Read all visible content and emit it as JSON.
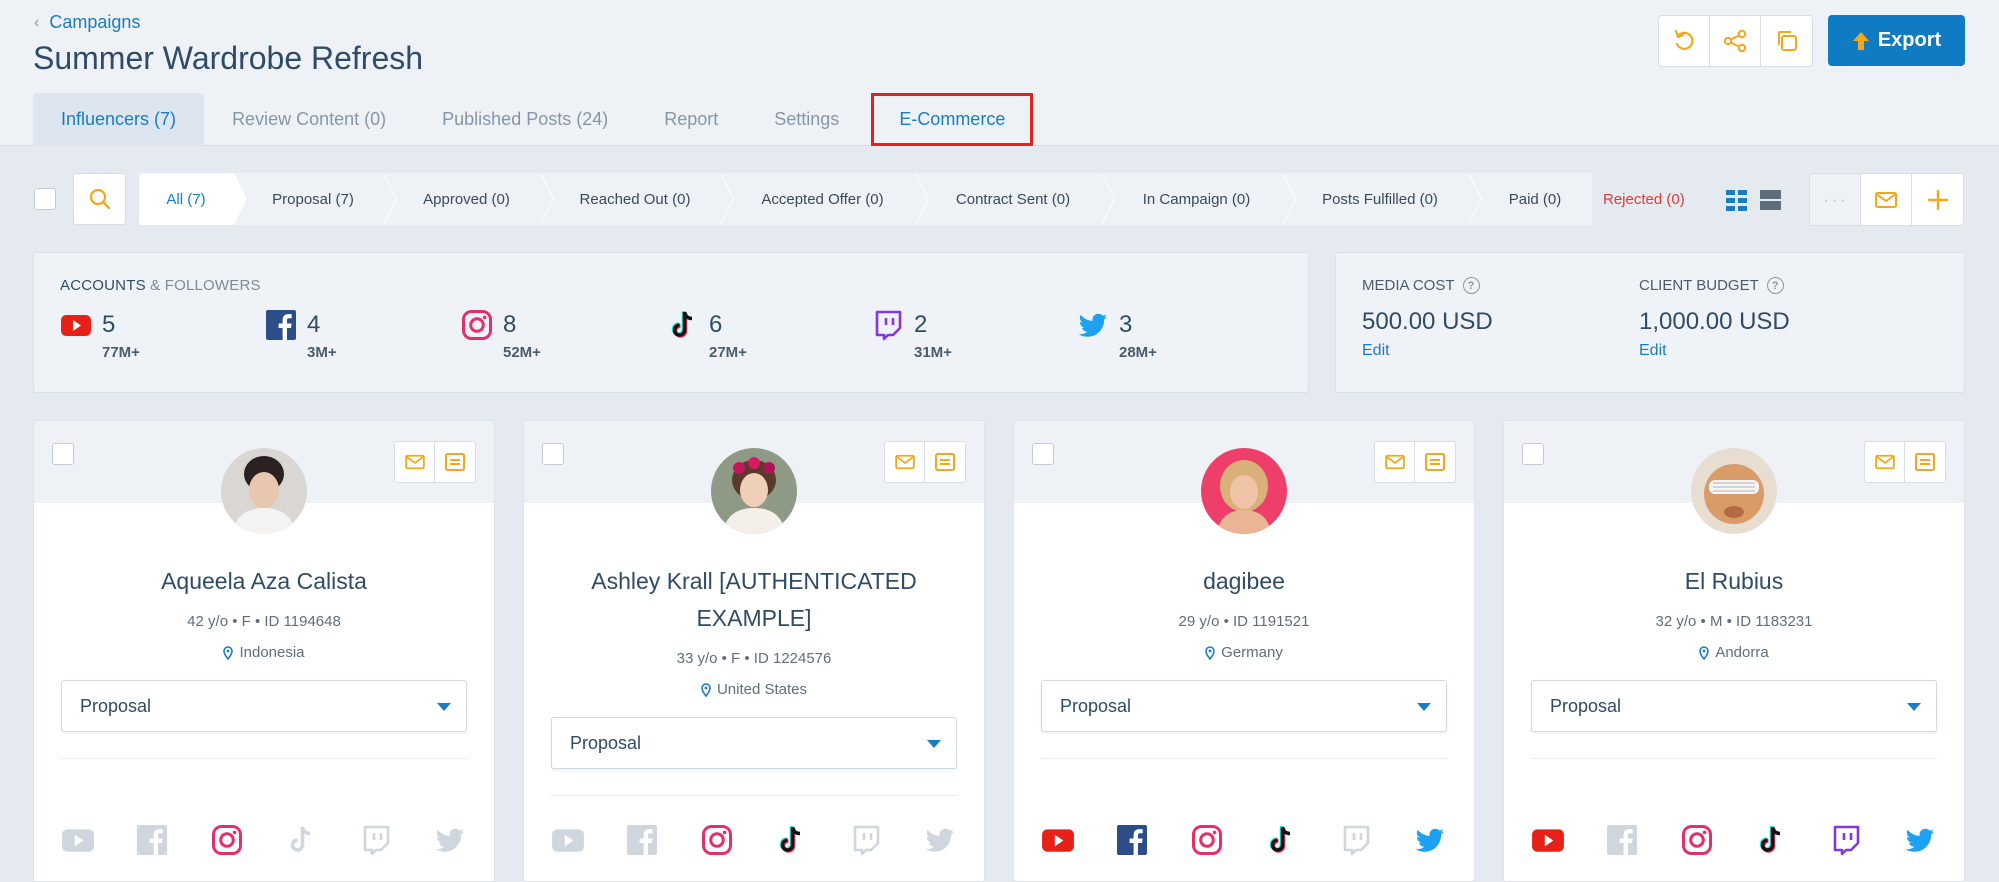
{
  "header": {
    "breadcrumb": "Campaigns",
    "title": "Summer Wardrobe Refresh",
    "export_label": "Export"
  },
  "tabs": [
    {
      "label": "Influencers (7)",
      "active": true
    },
    {
      "label": "Review Content (0)"
    },
    {
      "label": "Published Posts (24)"
    },
    {
      "label": "Report"
    },
    {
      "label": "Settings"
    },
    {
      "label": "E-Commerce",
      "highlighted": true
    }
  ],
  "stages": [
    {
      "label": "All (7)",
      "selected": true
    },
    {
      "label": "Proposal (7)"
    },
    {
      "label": "Approved (0)"
    },
    {
      "label": "Reached Out (0)"
    },
    {
      "label": "Accepted Offer (0)"
    },
    {
      "label": "Contract Sent (0)"
    },
    {
      "label": "In Campaign (0)"
    },
    {
      "label": "Posts Fulfilled (0)"
    },
    {
      "label": "Paid (0)"
    }
  ],
  "rejected_label": "Rejected (0)",
  "accounts": {
    "title_part1": "ACCOUNTS",
    "title_part2": "& FOLLOWERS",
    "items": [
      {
        "platform": "youtube-icon",
        "count": "5",
        "followers": "77M+"
      },
      {
        "platform": "facebook-icon",
        "count": "4",
        "followers": "3M+"
      },
      {
        "platform": "instagram-icon",
        "count": "8",
        "followers": "52M+"
      },
      {
        "platform": "tiktok-icon",
        "count": "6",
        "followers": "27M+"
      },
      {
        "platform": "twitch-icon",
        "count": "2",
        "followers": "31M+"
      },
      {
        "platform": "twitter-icon",
        "count": "3",
        "followers": "28M+"
      }
    ]
  },
  "costs": {
    "media_cost_label": "MEDIA COST",
    "media_cost_value": "500.00 USD",
    "client_budget_label": "CLIENT BUDGET",
    "client_budget_value": "1,000.00 USD",
    "edit_label": "Edit",
    "help_glyph": "?"
  },
  "cards": [
    {
      "name": "Aqueela Aza Calista",
      "meta": "42 y/o • F • ID 1194648",
      "location": "Indonesia",
      "status": "Proposal",
      "active": [
        false,
        false,
        true,
        false,
        false,
        false
      ]
    },
    {
      "name": "Ashley Krall [AUTHENTICATED EXAMPLE]",
      "meta": "33 y/o • F • ID 1224576",
      "location": "United States",
      "status": "Proposal",
      "active": [
        false,
        false,
        true,
        true,
        false,
        false
      ]
    },
    {
      "name": "dagibee",
      "meta": "29 y/o • ID 1191521",
      "location": "Germany",
      "status": "Proposal",
      "active": [
        true,
        true,
        true,
        true,
        false,
        true
      ]
    },
    {
      "name": "El Rubius",
      "meta": "32 y/o • M • ID 1183231",
      "location": "Andorra",
      "status": "Proposal",
      "active": [
        true,
        false,
        true,
        true,
        true,
        true
      ]
    }
  ],
  "colors": {
    "accent": "#1a7cc1",
    "warning": "#f2a81d",
    "rejected": "#e23b3b",
    "highlight_box": "#e4221d"
  },
  "icons": {
    "dots": "···"
  }
}
